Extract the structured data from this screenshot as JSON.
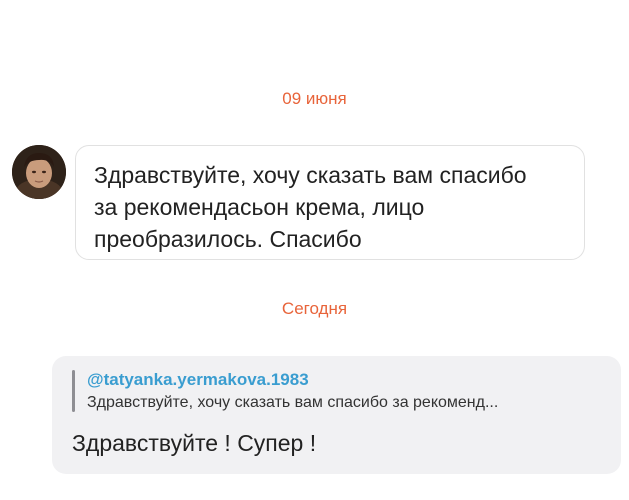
{
  "thread": {
    "date_separator_1": "09 июня",
    "date_separator_2": "Сегодня"
  },
  "incoming_message": {
    "avatar_icon": "user-avatar-photo",
    "text": "Здравствуйте, хочу сказать вам спасибо\nза рекомендасьон крема, лицо\nпреобразилось. Спасибо"
  },
  "outgoing_reply": {
    "quoted_username": "@tatyanka.yermakova.1983",
    "quoted_text": "Здравствуйте, хочу сказать вам спасибо за рекоменд...",
    "text": "Здравствуйте ! Супер !"
  },
  "colors": {
    "date_accent": "#e8643a",
    "quote_username": "#3a9dd0",
    "reply_bubble_bg": "#f1f1f3",
    "incoming_bubble_border": "#e1e1e1"
  }
}
